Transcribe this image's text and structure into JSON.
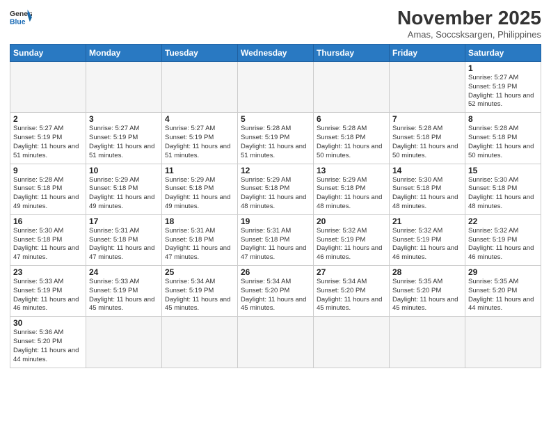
{
  "header": {
    "logo_general": "General",
    "logo_blue": "Blue",
    "month_title": "November 2025",
    "location": "Amas, Soccsksargen, Philippines"
  },
  "days_of_week": [
    "Sunday",
    "Monday",
    "Tuesday",
    "Wednesday",
    "Thursday",
    "Friday",
    "Saturday"
  ],
  "weeks": [
    [
      {
        "day": "",
        "info": ""
      },
      {
        "day": "",
        "info": ""
      },
      {
        "day": "",
        "info": ""
      },
      {
        "day": "",
        "info": ""
      },
      {
        "day": "",
        "info": ""
      },
      {
        "day": "",
        "info": ""
      },
      {
        "day": "1",
        "info": "Sunrise: 5:27 AM\nSunset: 5:19 PM\nDaylight: 11 hours\nand 52 minutes."
      }
    ],
    [
      {
        "day": "2",
        "info": "Sunrise: 5:27 AM\nSunset: 5:19 PM\nDaylight: 11 hours\nand 51 minutes."
      },
      {
        "day": "3",
        "info": "Sunrise: 5:27 AM\nSunset: 5:19 PM\nDaylight: 11 hours\nand 51 minutes."
      },
      {
        "day": "4",
        "info": "Sunrise: 5:27 AM\nSunset: 5:19 PM\nDaylight: 11 hours\nand 51 minutes."
      },
      {
        "day": "5",
        "info": "Sunrise: 5:28 AM\nSunset: 5:19 PM\nDaylight: 11 hours\nand 51 minutes."
      },
      {
        "day": "6",
        "info": "Sunrise: 5:28 AM\nSunset: 5:18 PM\nDaylight: 11 hours\nand 50 minutes."
      },
      {
        "day": "7",
        "info": "Sunrise: 5:28 AM\nSunset: 5:18 PM\nDaylight: 11 hours\nand 50 minutes."
      },
      {
        "day": "8",
        "info": "Sunrise: 5:28 AM\nSunset: 5:18 PM\nDaylight: 11 hours\nand 50 minutes."
      }
    ],
    [
      {
        "day": "9",
        "info": "Sunrise: 5:28 AM\nSunset: 5:18 PM\nDaylight: 11 hours\nand 49 minutes."
      },
      {
        "day": "10",
        "info": "Sunrise: 5:29 AM\nSunset: 5:18 PM\nDaylight: 11 hours\nand 49 minutes."
      },
      {
        "day": "11",
        "info": "Sunrise: 5:29 AM\nSunset: 5:18 PM\nDaylight: 11 hours\nand 49 minutes."
      },
      {
        "day": "12",
        "info": "Sunrise: 5:29 AM\nSunset: 5:18 PM\nDaylight: 11 hours\nand 48 minutes."
      },
      {
        "day": "13",
        "info": "Sunrise: 5:29 AM\nSunset: 5:18 PM\nDaylight: 11 hours\nand 48 minutes."
      },
      {
        "day": "14",
        "info": "Sunrise: 5:30 AM\nSunset: 5:18 PM\nDaylight: 11 hours\nand 48 minutes."
      },
      {
        "day": "15",
        "info": "Sunrise: 5:30 AM\nSunset: 5:18 PM\nDaylight: 11 hours\nand 48 minutes."
      }
    ],
    [
      {
        "day": "16",
        "info": "Sunrise: 5:30 AM\nSunset: 5:18 PM\nDaylight: 11 hours\nand 47 minutes."
      },
      {
        "day": "17",
        "info": "Sunrise: 5:31 AM\nSunset: 5:18 PM\nDaylight: 11 hours\nand 47 minutes."
      },
      {
        "day": "18",
        "info": "Sunrise: 5:31 AM\nSunset: 5:18 PM\nDaylight: 11 hours\nand 47 minutes."
      },
      {
        "day": "19",
        "info": "Sunrise: 5:31 AM\nSunset: 5:18 PM\nDaylight: 11 hours\nand 47 minutes."
      },
      {
        "day": "20",
        "info": "Sunrise: 5:32 AM\nSunset: 5:19 PM\nDaylight: 11 hours\nand 46 minutes."
      },
      {
        "day": "21",
        "info": "Sunrise: 5:32 AM\nSunset: 5:19 PM\nDaylight: 11 hours\nand 46 minutes."
      },
      {
        "day": "22",
        "info": "Sunrise: 5:32 AM\nSunset: 5:19 PM\nDaylight: 11 hours\nand 46 minutes."
      }
    ],
    [
      {
        "day": "23",
        "info": "Sunrise: 5:33 AM\nSunset: 5:19 PM\nDaylight: 11 hours\nand 46 minutes."
      },
      {
        "day": "24",
        "info": "Sunrise: 5:33 AM\nSunset: 5:19 PM\nDaylight: 11 hours\nand 45 minutes."
      },
      {
        "day": "25",
        "info": "Sunrise: 5:34 AM\nSunset: 5:19 PM\nDaylight: 11 hours\nand 45 minutes."
      },
      {
        "day": "26",
        "info": "Sunrise: 5:34 AM\nSunset: 5:20 PM\nDaylight: 11 hours\nand 45 minutes."
      },
      {
        "day": "27",
        "info": "Sunrise: 5:34 AM\nSunset: 5:20 PM\nDaylight: 11 hours\nand 45 minutes."
      },
      {
        "day": "28",
        "info": "Sunrise: 5:35 AM\nSunset: 5:20 PM\nDaylight: 11 hours\nand 45 minutes."
      },
      {
        "day": "29",
        "info": "Sunrise: 5:35 AM\nSunset: 5:20 PM\nDaylight: 11 hours\nand 44 minutes."
      }
    ],
    [
      {
        "day": "30",
        "info": "Sunrise: 5:36 AM\nSunset: 5:20 PM\nDaylight: 11 hours\nand 44 minutes."
      },
      {
        "day": "",
        "info": ""
      },
      {
        "day": "",
        "info": ""
      },
      {
        "day": "",
        "info": ""
      },
      {
        "day": "",
        "info": ""
      },
      {
        "day": "",
        "info": ""
      },
      {
        "day": "",
        "info": ""
      }
    ]
  ]
}
